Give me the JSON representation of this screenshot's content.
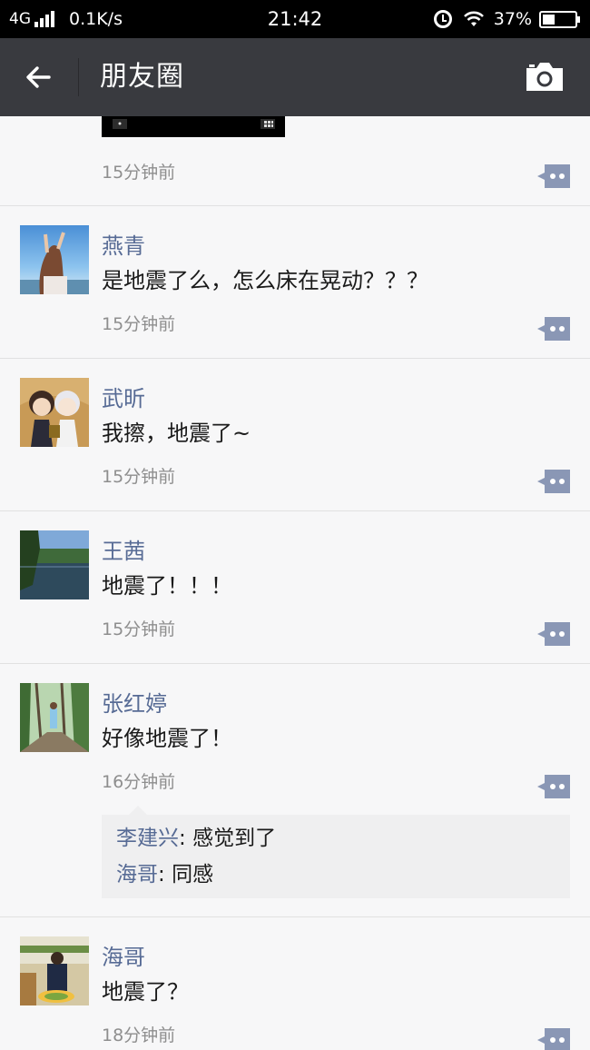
{
  "status_bar": {
    "network": "4G",
    "speed": "0.1K/s",
    "time": "21:42",
    "battery": "37%",
    "battery_level": 0.37
  },
  "header": {
    "title": "朋友圈"
  },
  "posts": [
    {
      "time": "15分钟前"
    },
    {
      "name": "燕青",
      "text": "是地震了么，怎么床在晃动？？？",
      "time": "15分钟前"
    },
    {
      "name": "武昕",
      "text": "我擦，地震了~",
      "time": "15分钟前"
    },
    {
      "name": "王茜",
      "text": "地震了！！！",
      "time": "15分钟前"
    },
    {
      "name": "张红婷",
      "text": "好像地震了！",
      "time": "16分钟前",
      "comments": [
        {
          "name": "李建兴",
          "sep": ": ",
          "text": "感觉到了"
        },
        {
          "name": "海哥",
          "sep": ": ",
          "text": "同感"
        }
      ]
    },
    {
      "name": "海哥",
      "text": "地震了？",
      "time": "18分钟前"
    }
  ],
  "colors": {
    "name_link": "#576b95",
    "header_bg": "#393a3f",
    "comment_icon": "#8a97b5"
  },
  "icons": {
    "back": "arrow-left-icon",
    "camera": "camera-icon",
    "comment": "comment-bubble-icon"
  }
}
